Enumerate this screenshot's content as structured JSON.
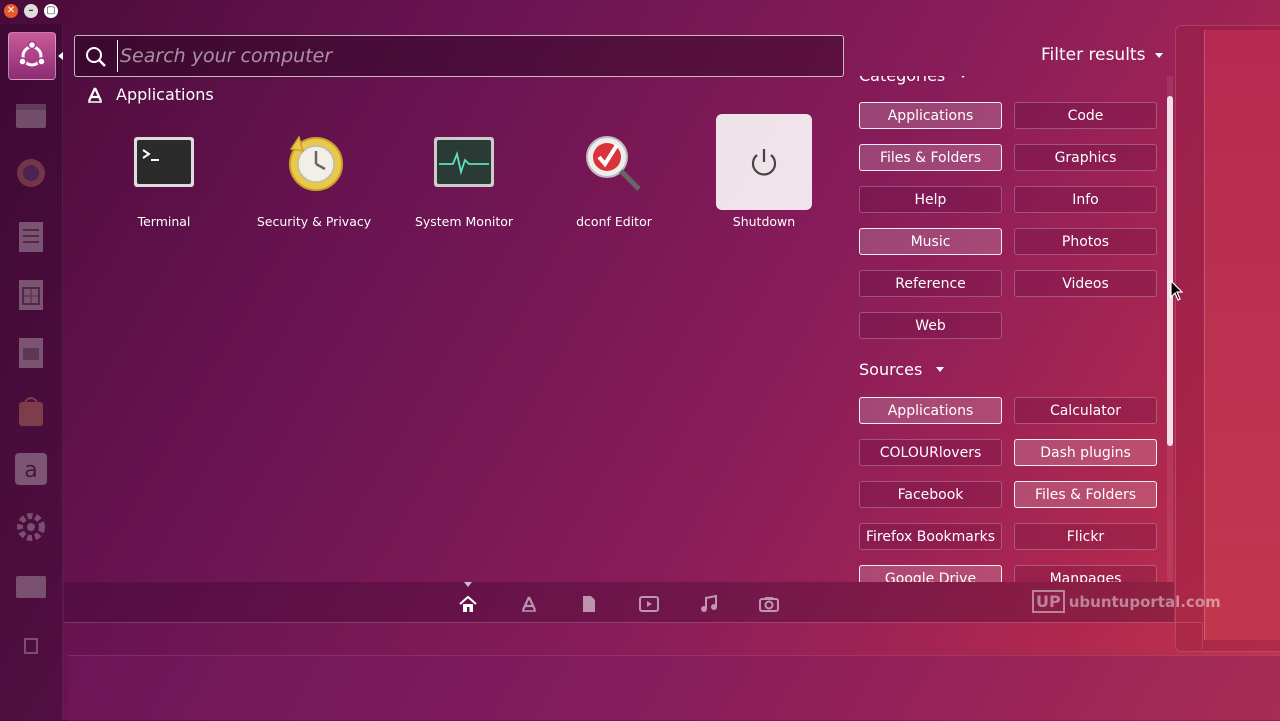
{
  "search": {
    "placeholder": "Search your computer"
  },
  "filter_results": {
    "label": "Filter results"
  },
  "section": {
    "label": "Applications"
  },
  "apps": [
    {
      "label": "Terminal"
    },
    {
      "label": "Security & Privacy"
    },
    {
      "label": "System Monitor"
    },
    {
      "label": "dconf Editor"
    },
    {
      "label": "Shutdown"
    }
  ],
  "categories": {
    "title": "Categories",
    "items": [
      {
        "label": "Applications",
        "active": true
      },
      {
        "label": "Code",
        "active": false
      },
      {
        "label": "Files & Folders",
        "active": true
      },
      {
        "label": "Graphics",
        "active": false
      },
      {
        "label": "Help",
        "active": false
      },
      {
        "label": "Info",
        "active": false
      },
      {
        "label": "Music",
        "active": true
      },
      {
        "label": "Photos",
        "active": false
      },
      {
        "label": "Reference",
        "active": false
      },
      {
        "label": "Videos",
        "active": false
      },
      {
        "label": "Web",
        "active": false
      }
    ]
  },
  "sources": {
    "title": "Sources",
    "items": [
      {
        "label": "Applications",
        "active": true
      },
      {
        "label": "Calculator",
        "active": false
      },
      {
        "label": "COLOURlovers",
        "active": false
      },
      {
        "label": "Dash plugins",
        "active": true
      },
      {
        "label": "Facebook",
        "active": false
      },
      {
        "label": "Files & Folders",
        "active": true
      },
      {
        "label": "Firefox Bookmarks",
        "active": false
      },
      {
        "label": "Flickr",
        "active": false
      },
      {
        "label": "Google Drive",
        "active": true
      },
      {
        "label": "Manpages",
        "active": false
      }
    ]
  },
  "lenses": [
    "home-icon",
    "applications-icon",
    "files-icon",
    "video-icon",
    "music-icon",
    "photo-icon"
  ],
  "watermark": {
    "box": "UP",
    "text": "ubuntuportal.com"
  },
  "colors": {
    "accent": "#e95a2c",
    "background": "#6b1452"
  }
}
